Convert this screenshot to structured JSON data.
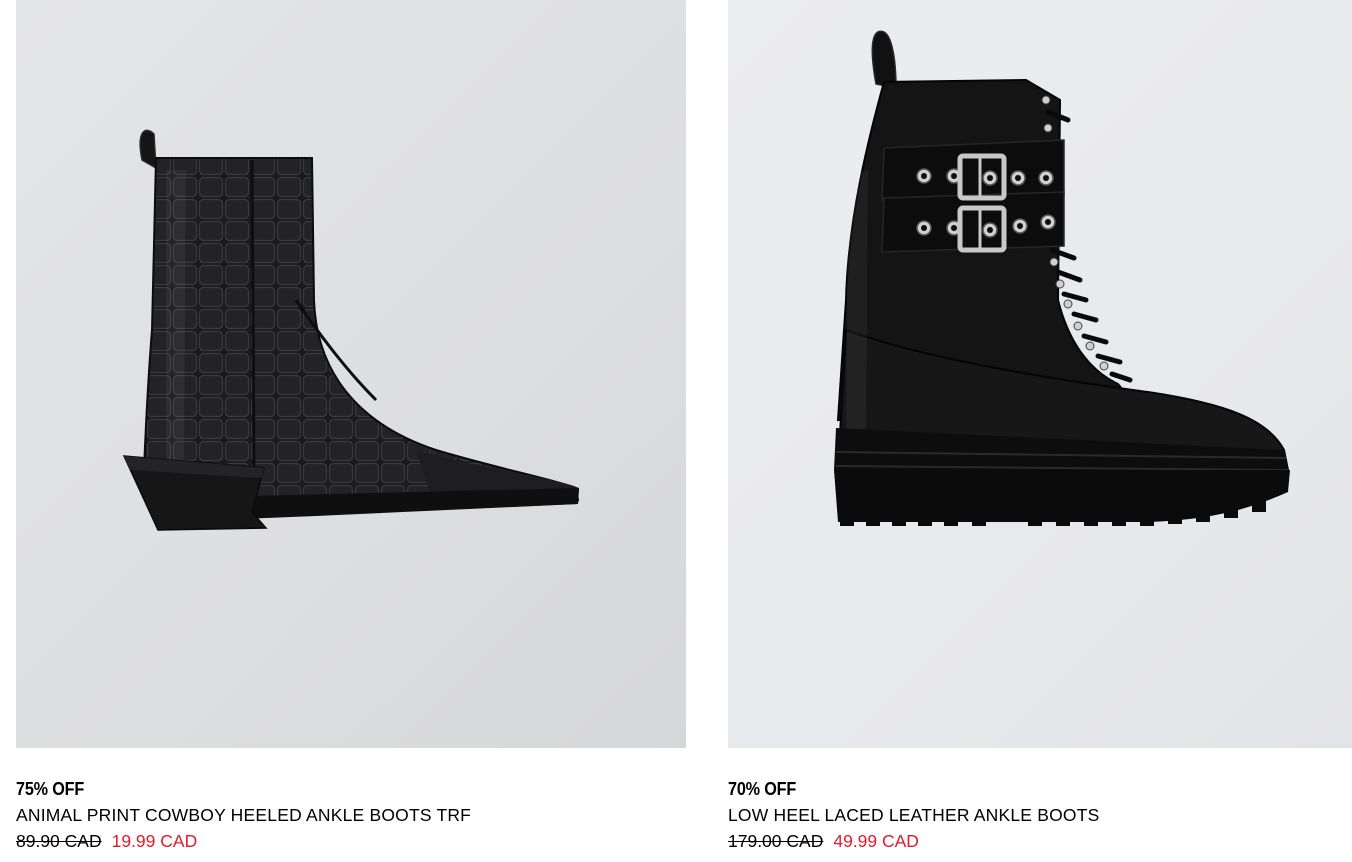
{
  "products": [
    {
      "image_icon": "cowboy-boot-image",
      "discount": "75% OFF",
      "name": "ANIMAL PRINT COWBOY HEELED ANKLE BOOTS TRF",
      "old_price": "89.90 CAD",
      "new_price": "19.99 CAD"
    },
    {
      "image_icon": "combat-boot-image",
      "discount": "70% OFF",
      "name": "LOW HEEL LACED LEATHER ANKLE BOOTS",
      "old_price": "179.00 CAD",
      "new_price": "49.99 CAD"
    }
  ],
  "colors": {
    "sale_price": "#e21b2c",
    "text": "#000000"
  }
}
